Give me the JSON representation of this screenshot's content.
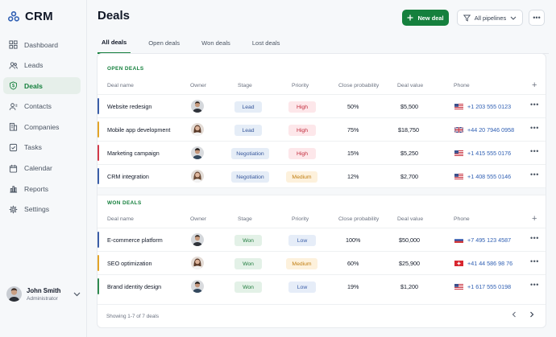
{
  "app": {
    "name": "CRM"
  },
  "sidebar": {
    "items": [
      {
        "label": "Dashboard",
        "icon": "dashboard-icon",
        "active": false
      },
      {
        "label": "Leads",
        "icon": "users-icon",
        "active": false
      },
      {
        "label": "Deals",
        "icon": "shield-dollar-icon",
        "active": true
      },
      {
        "label": "Contacts",
        "icon": "contact-icon",
        "active": false
      },
      {
        "label": "Companies",
        "icon": "building-icon",
        "active": false
      },
      {
        "label": "Tasks",
        "icon": "checkbox-icon",
        "active": false
      },
      {
        "label": "Calendar",
        "icon": "calendar-icon",
        "active": false
      },
      {
        "label": "Reports",
        "icon": "bar-chart-icon",
        "active": false
      },
      {
        "label": "Settings",
        "icon": "gear-icon",
        "active": false
      }
    ],
    "user": {
      "name": "John Smith",
      "role": "Administrator"
    }
  },
  "header": {
    "title": "Deals",
    "new_label": "New deal",
    "pipelines_label": "All pipelines"
  },
  "tabs": [
    {
      "label": "All deals",
      "active": true
    },
    {
      "label": "Open deals",
      "active": false
    },
    {
      "label": "Won deals",
      "active": false
    },
    {
      "label": "Lost deals",
      "active": false
    }
  ],
  "columns": [
    "Deal name",
    "Owner",
    "Stage",
    "Priority",
    "Close probability",
    "Deal value",
    "Phone"
  ],
  "open_section": {
    "label": "OPEN DEALS",
    "rows": [
      {
        "name": "Website redesign",
        "stage": "Lead",
        "priority": "High",
        "probability": "50%",
        "value": "$5,500",
        "phone": "+1 203 555 0123",
        "flag": "us",
        "accent": "#3b5ea8"
      },
      {
        "name": "Mobile app development",
        "stage": "Lead",
        "priority": "High",
        "probability": "75%",
        "value": "$18,750",
        "phone": "+44 20 7946 0958",
        "flag": "uk",
        "accent": "#e2a427"
      },
      {
        "name": "Marketing campaign",
        "stage": "Negotiation",
        "priority": "High",
        "probability": "15%",
        "value": "$5,250",
        "phone": "+1 415 555 0176",
        "flag": "us",
        "accent": "#d23a4a"
      },
      {
        "name": "CRM integration",
        "stage": "Negotiation",
        "priority": "Medium",
        "probability": "12%",
        "value": "$2,700",
        "phone": "+1 408 555 0146",
        "flag": "us",
        "accent": "#3b5ea8"
      }
    ]
  },
  "won_section": {
    "label": "WON DEALS",
    "rows": [
      {
        "name": "E-commerce platform",
        "stage": "Won",
        "priority": "Low",
        "probability": "100%",
        "value": "$50,000",
        "phone": "+7 495 123 4587",
        "flag": "ru",
        "accent": "#3b5ea8"
      },
      {
        "name": "SEO optimization",
        "stage": "Won",
        "priority": "Medium",
        "probability": "60%",
        "value": "$25,900",
        "phone": "+41 44 586 98 76",
        "flag": "ch",
        "accent": "#e2a427"
      },
      {
        "name": "Brand identity design",
        "stage": "Won",
        "priority": "Low",
        "probability": "19%",
        "value": "$1,200",
        "phone": "+1 617 555 0198",
        "flag": "us",
        "accent": "#2f8a4f"
      }
    ]
  },
  "footer": {
    "showing": "Showing 1-7 of 7 deals"
  }
}
